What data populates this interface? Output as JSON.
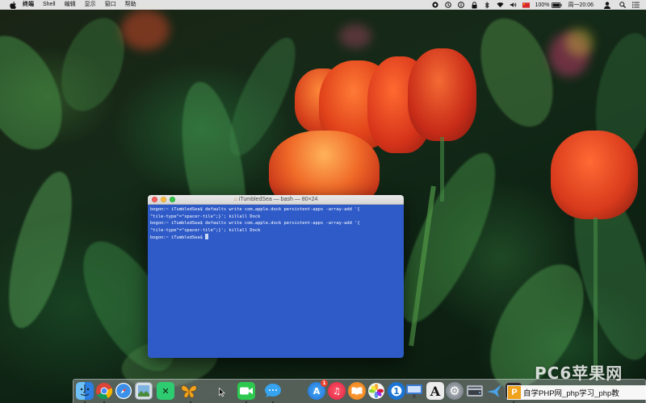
{
  "menubar": {
    "app_name": "终端",
    "items": [
      "Shell",
      "编辑",
      "显示",
      "窗口",
      "帮助"
    ],
    "clock": "周一20:06",
    "battery": "100%",
    "status_icons": [
      "record-icon",
      "timer-icon",
      "info-icon",
      "lock-icon",
      "bluetooth-icon",
      "wifi-icon",
      "volume-icon",
      "input-flag-icon",
      "battery-icon",
      "user-icon",
      "spotlight-icon",
      "notification-icon"
    ]
  },
  "terminal": {
    "title": "iTumbledSea — bash — 80×24",
    "lines": [
      "bogon:~ iTumbledSea$ defaults write com.apple.dock persistent-apps -array-add '{",
      "\"tile-type\"=\"spacer-tile\";}'; killall Dock",
      "bogon:~ iTumbledSea$ defaults write com.apple.dock persistent-apps -array-add '{",
      "\"tile-type\"=\"spacer-tile\";}'; killall Dock",
      "bogon:~ iTumbledSea$ "
    ],
    "background": "#2f5bc8"
  },
  "dock": {
    "items": [
      {
        "name": "finder-icon",
        "glyph": "",
        "color": "#3b8fe6"
      },
      {
        "name": "chrome-icon",
        "glyph": "",
        "color": "#e8e8e8"
      },
      {
        "name": "safari-icon",
        "glyph": "",
        "color": "#3a8fe8"
      },
      {
        "name": "preview-icon",
        "glyph": "",
        "color": "#c9d3dc"
      },
      {
        "name": "xmind-icon",
        "glyph": "✕",
        "color": "#2ecc71"
      },
      {
        "name": "butterfly-app-icon",
        "glyph": "",
        "color": "#f1a31e"
      },
      {
        "name": "facetime-icon",
        "glyph": "",
        "color": "#2dc94f"
      },
      {
        "name": "messages-icon",
        "glyph": "",
        "color": "#36a4ef"
      },
      {
        "name": "app-store-icon",
        "glyph": "A",
        "color": "#2389e6"
      },
      {
        "name": "music-icon",
        "glyph": "♫",
        "color": "#f2344f"
      },
      {
        "name": "books-icon",
        "glyph": "",
        "color": "#f08a1e"
      },
      {
        "name": "photos-icon",
        "glyph": "",
        "color": "#f4f4f4"
      },
      {
        "name": "1password-icon",
        "glyph": "1",
        "color": "#1b74d4"
      },
      {
        "name": "keynote-icon",
        "glyph": "",
        "color": "#3a7bd5"
      },
      {
        "name": "font-book-icon",
        "glyph": "A",
        "color": "#e8e8e8"
      },
      {
        "name": "system-preferences-icon",
        "glyph": "⚙",
        "color": "#8a8f96"
      },
      {
        "name": "disk-utility-icon",
        "glyph": "",
        "color": "#c8ccd2"
      },
      {
        "name": "bird-app-icon",
        "glyph": "✈",
        "color": "#4aa3e6"
      },
      {
        "name": "terminal-icon",
        "glyph": ">_",
        "color": "#2b2b2b"
      }
    ],
    "badges": {
      "app-store-icon": "1"
    }
  },
  "watermarks": {
    "large": "PC6苹果网",
    "bar_logo": "P",
    "bar_text": "自学PHP网_php学习_php教"
  }
}
